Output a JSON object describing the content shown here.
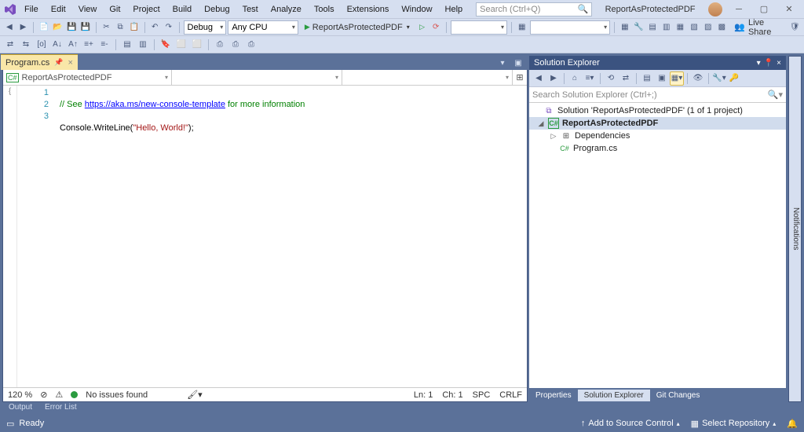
{
  "menu": [
    "File",
    "Edit",
    "View",
    "Git",
    "Project",
    "Build",
    "Debug",
    "Test",
    "Analyze",
    "Tools",
    "Extensions",
    "Window",
    "Help"
  ],
  "search_placeholder": "Search (Ctrl+Q)",
  "title": "ReportAsProtectedPDF",
  "toolbar1": {
    "config": "Debug",
    "platform": "Any CPU",
    "run_label": "ReportAsProtectedPDF"
  },
  "live_share": "Live Share",
  "tab": {
    "name": "Program.cs"
  },
  "nav": {
    "left": "ReportAsProtectedPDF",
    "middle": "",
    "right": ""
  },
  "code": {
    "lines": [
      "1",
      "2",
      "3"
    ],
    "l1_a": "// See ",
    "l1_link": "https://aka.ms/new-console-template",
    "l1_b": " for more information",
    "l2_a": "Console.WriteLine(",
    "l2_str": "\"Hello, World!\"",
    "l2_b": ");"
  },
  "editor_status": {
    "zoom": "120 %",
    "issues": "No issues found",
    "ln": "Ln: 1",
    "ch": "Ch: 1",
    "spc": "SPC",
    "crlf": "CRLF"
  },
  "solution_explorer": {
    "title": "Solution Explorer",
    "search_placeholder": "Search Solution Explorer (Ctrl+;)",
    "solution": "Solution 'ReportAsProtectedPDF' (1 of 1 project)",
    "project": "ReportAsProtectedPDF",
    "dependencies": "Dependencies",
    "file": "Program.cs"
  },
  "right_tabs": [
    "Properties",
    "Solution Explorer",
    "Git Changes"
  ],
  "bottom_tabs": [
    "Output",
    "Error List"
  ],
  "notifications_label": "Notifications",
  "status": {
    "ready": "Ready",
    "source_control": "Add to Source Control",
    "repo": "Select Repository"
  }
}
